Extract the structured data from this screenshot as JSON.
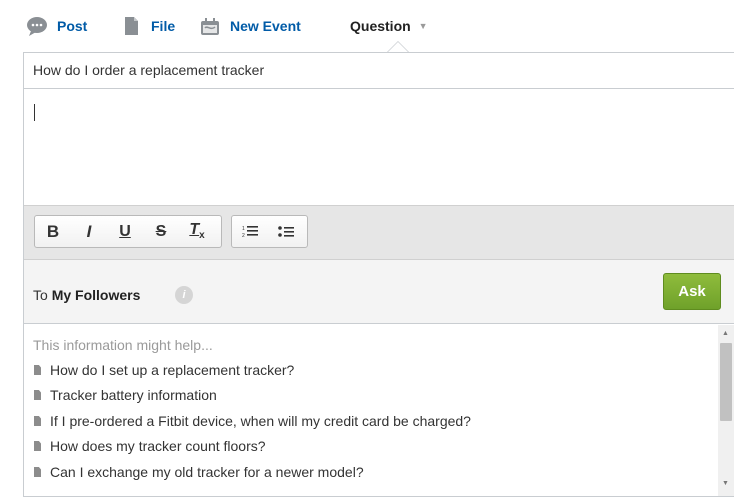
{
  "publisher": {
    "tabs": [
      {
        "label": "Post",
        "icon": "speech-bubble-icon"
      },
      {
        "label": "File",
        "icon": "file-icon"
      },
      {
        "label": "New Event",
        "icon": "calendar-event-icon"
      },
      {
        "label": "Question",
        "icon": "dropdown-caret-icon",
        "active": true
      }
    ]
  },
  "question": {
    "value": "How do I order a replacement tracker"
  },
  "details": {
    "value": ""
  },
  "toolbar": {
    "bold": "B",
    "italic": "I",
    "underline": "U",
    "strike": "S",
    "clear_format": "T",
    "clear_format_sub": "x"
  },
  "share": {
    "prefix": "To ",
    "target": "My Followers",
    "info_icon": "i",
    "ask_label": "Ask"
  },
  "suggestions": {
    "heading": "This information might help...",
    "items": [
      "How do I set up a replacement tracker?",
      "Tracker battery information",
      "If I pre-ordered a Fitbit device, when will my credit card be charged?",
      "How does my tracker count floors?",
      "Can I exchange my old tracker for a newer model?"
    ]
  },
  "colors": {
    "link_blue": "#015ba7",
    "ask_green": "#7cae30",
    "toolbar_bg": "#e6e6e6"
  }
}
